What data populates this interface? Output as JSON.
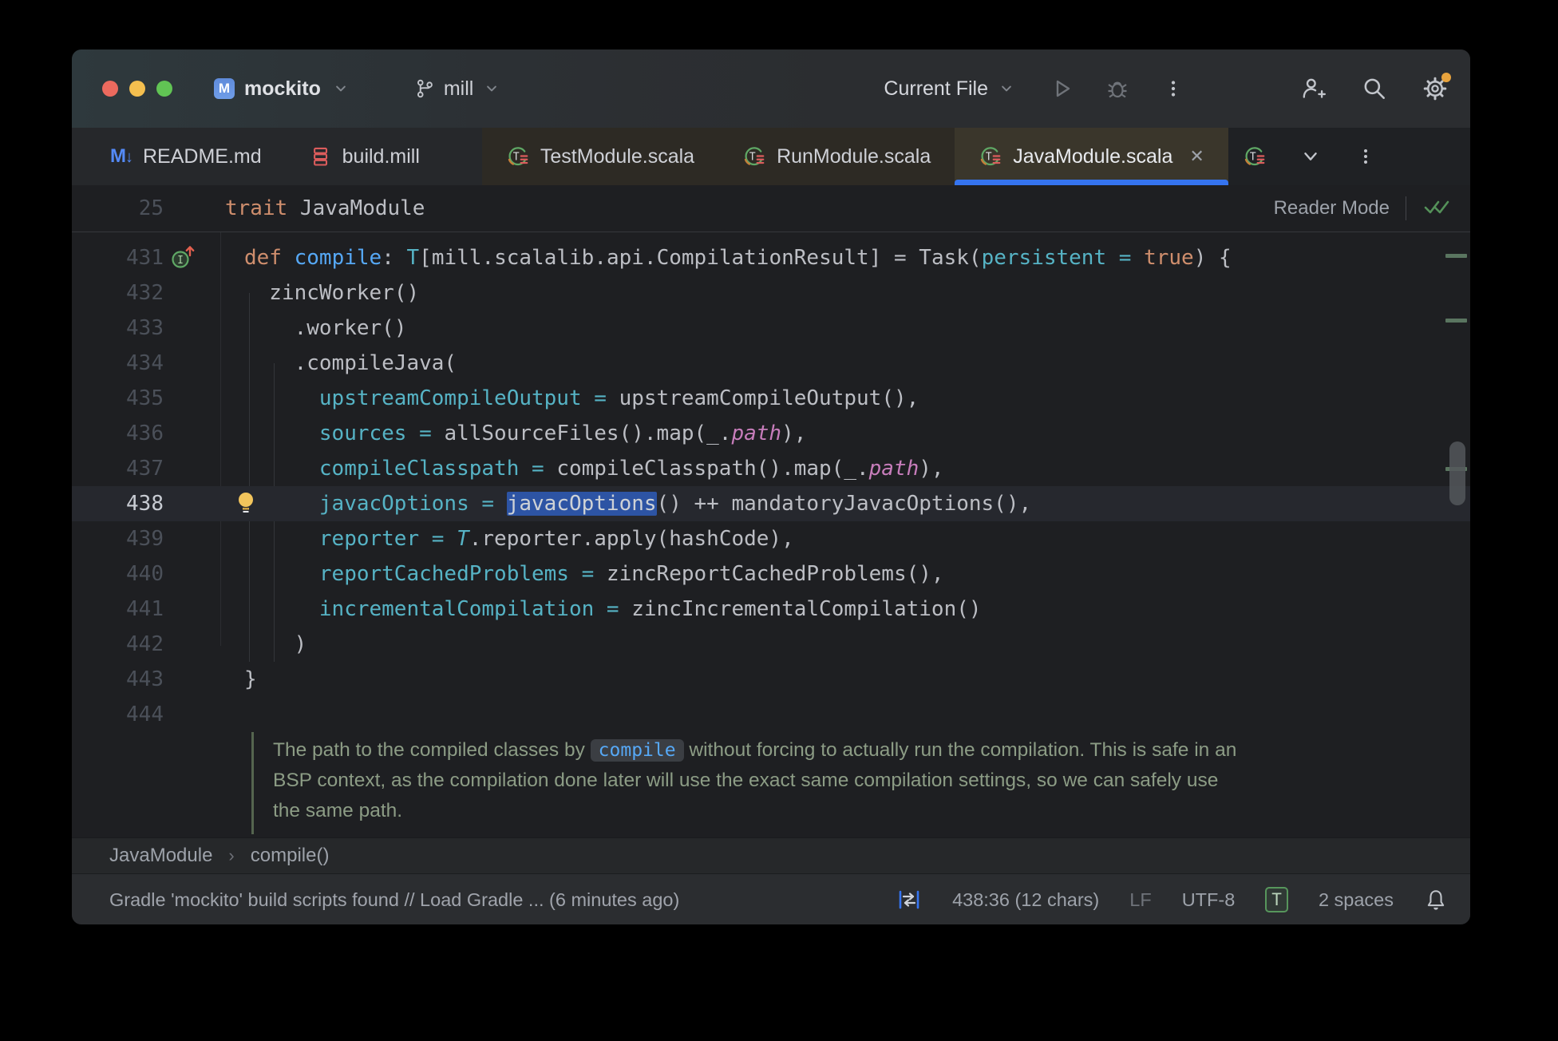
{
  "colors": {
    "accent_blue": "#3574F0",
    "selection": "#2D54A4",
    "keyword": "#CF8E6D",
    "function": "#56A8F5",
    "named_arg": "#56B3C5",
    "field": "#C77DBB",
    "doc_green": "#8C9C85",
    "notification_dot": "#E8A33D",
    "badge_green": "#57965C"
  },
  "titlebar": {
    "project": "mockito",
    "branch": "mill",
    "run_config": "Current File"
  },
  "tabs": [
    {
      "label": "README.md",
      "icon": "markdown",
      "tint": "cool"
    },
    {
      "label": "build.mill",
      "icon": "mill",
      "tint": "cool"
    },
    {
      "label": "TestModule.scala",
      "icon": "scala-trait",
      "tint": "warm"
    },
    {
      "label": "RunModule.scala",
      "icon": "scala-trait",
      "tint": "warm"
    },
    {
      "label": "JavaModule.scala",
      "icon": "scala-trait",
      "tint": "warm",
      "active": true,
      "close": "✕"
    },
    {
      "label": "",
      "icon": "scala-trait",
      "tint": "overflow"
    }
  ],
  "sticky": {
    "line_number": "25",
    "keyword": "trait ",
    "name": "JavaModule",
    "reader_mode": "Reader Mode"
  },
  "editor": {
    "lines": [
      {
        "no": "431",
        "indent": 0,
        "gutter_icon": "implements",
        "segments": [
          {
            "c": "kw",
            "t": "def "
          },
          {
            "c": "fn",
            "t": "compile"
          },
          {
            "c": "pl",
            "t": ": "
          },
          {
            "c": "ty",
            "t": "T"
          },
          {
            "c": "pl",
            "t": "[mill.scalalib.api.CompilationResult] = Task("
          },
          {
            "c": "named",
            "t": "persistent"
          },
          {
            "c": "named",
            "t": " = "
          },
          {
            "c": "kw",
            "t": "true"
          },
          {
            "c": "pl",
            "t": ") {"
          }
        ]
      },
      {
        "no": "432",
        "indent": 2,
        "segments": [
          {
            "c": "pl",
            "t": "zincWorker()"
          }
        ]
      },
      {
        "no": "433",
        "indent": 4,
        "segments": [
          {
            "c": "pl",
            "t": ".worker()"
          }
        ]
      },
      {
        "no": "434",
        "indent": 4,
        "segments": [
          {
            "c": "pl",
            "t": ".compileJava("
          }
        ]
      },
      {
        "no": "435",
        "indent": 6,
        "segments": [
          {
            "c": "named",
            "t": "upstreamCompileOutput"
          },
          {
            "c": "named",
            "t": " = "
          },
          {
            "c": "pl",
            "t": "upstreamCompileOutput(),"
          }
        ]
      },
      {
        "no": "436",
        "indent": 6,
        "segments": [
          {
            "c": "named",
            "t": "sources"
          },
          {
            "c": "named",
            "t": " = "
          },
          {
            "c": "pl",
            "t": "allSourceFiles().map(_."
          },
          {
            "c": "fld",
            "t": "path"
          },
          {
            "c": "pl",
            "t": "),"
          }
        ]
      },
      {
        "no": "437",
        "indent": 6,
        "segments": [
          {
            "c": "named",
            "t": "compileClasspath"
          },
          {
            "c": "named",
            "t": " = "
          },
          {
            "c": "pl",
            "t": "compileClasspath().map(_."
          },
          {
            "c": "fld",
            "t": "path"
          },
          {
            "c": "pl",
            "t": "),"
          }
        ]
      },
      {
        "no": "438",
        "indent": 6,
        "current": true,
        "bulb": true,
        "segments": [
          {
            "c": "named",
            "t": "javacOptions"
          },
          {
            "c": "named",
            "t": " = "
          },
          {
            "c": "sel",
            "t": "javacOptions"
          },
          {
            "c": "pl",
            "t": "() ++ mandatoryJavacOptions(),"
          }
        ]
      },
      {
        "no": "439",
        "indent": 6,
        "segments": [
          {
            "c": "named",
            "t": "reporter"
          },
          {
            "c": "named",
            "t": " = "
          },
          {
            "c": "tyi",
            "t": "T"
          },
          {
            "c": "pl",
            "t": ".reporter.apply(hashCode),"
          }
        ]
      },
      {
        "no": "440",
        "indent": 6,
        "segments": [
          {
            "c": "named",
            "t": "reportCachedProblems"
          },
          {
            "c": "named",
            "t": " = "
          },
          {
            "c": "pl",
            "t": "zincReportCachedProblems(),"
          }
        ]
      },
      {
        "no": "441",
        "indent": 6,
        "segments": [
          {
            "c": "named",
            "t": "incrementalCompilation"
          },
          {
            "c": "named",
            "t": " = "
          },
          {
            "c": "pl",
            "t": "zincIncrementalCompilation()"
          }
        ]
      },
      {
        "no": "442",
        "indent": 4,
        "segments": [
          {
            "c": "pl",
            "t": ")"
          }
        ]
      },
      {
        "no": "443",
        "indent": 0,
        "segments": [
          {
            "c": "pl",
            "t": "}"
          }
        ]
      },
      {
        "no": "444",
        "indent": 0,
        "segments": []
      }
    ]
  },
  "doc": {
    "before": "The path to the compiled classes by ",
    "code": "compile",
    "after": " without forcing to actually run the compilation. This is safe in an BSP context, as the compilation done later will use the exact same compilation settings, so we can safely use the same path."
  },
  "breadcrumbs": {
    "items": [
      "JavaModule",
      "compile()"
    ],
    "separator": "›"
  },
  "statusbar": {
    "message": "Gradle 'mockito' build scripts found // Load Gradle ... (6 minutes ago)",
    "position": "438:36 (12 chars)",
    "line_ending": "LF",
    "encoding": "UTF-8",
    "file_type_badge": "T",
    "indent": "2 spaces"
  },
  "icons": [
    "markdown-icon",
    "mill-icon",
    "scala-trait-icon",
    "git-branch-icon",
    "chevron-down-icon",
    "run-icon",
    "debug-icon",
    "more-vertical-icon",
    "add-user-icon",
    "search-icon",
    "settings-gear-icon",
    "reader-ok-checks-icon",
    "implements-gutter-icon",
    "lightbulb-icon",
    "column-mode-icon",
    "notifications-bell-icon",
    "close-icon"
  ]
}
